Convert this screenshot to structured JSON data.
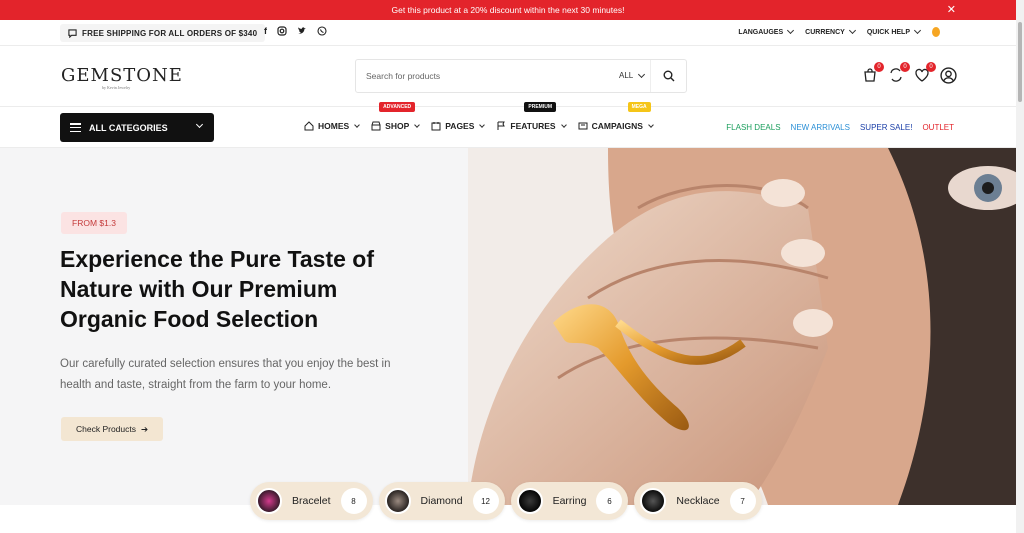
{
  "announcement": {
    "text": "Get this product at a 20% discount within the next 30 minutes!",
    "close_glyph": "✕"
  },
  "topbar": {
    "shipping": "FREE SHIPPING FOR ALL ORDERS OF $340",
    "socials": [
      "facebook-icon",
      "instagram-icon",
      "twitter-icon",
      "viber-icon"
    ],
    "languages": "LANGAUGES",
    "currency": "CURRENCY",
    "quick_help": "QUICK HELP"
  },
  "header": {
    "logo": "GEMSTONE",
    "logo_sub": "by Kevin Jewelry",
    "search_placeholder": "Search for products",
    "search_category": "ALL",
    "cart_count": "0",
    "compare_count": "0",
    "wishlist_count": "0"
  },
  "nav": {
    "all_categories": "ALL CATEGORIES",
    "menu": [
      {
        "label": "HOMES",
        "tag": ""
      },
      {
        "label": "SHOP",
        "tag": "ADVANCED"
      },
      {
        "label": "PAGES",
        "tag": ""
      },
      {
        "label": "FEATURES",
        "tag": "PREMIUM"
      },
      {
        "label": "CAMPAIGNS",
        "tag": "MEGA"
      }
    ],
    "promo": [
      {
        "label": "FLASH DEALS",
        "color": "#1a9e5c"
      },
      {
        "label": "NEW ARRIVALS",
        "color": "#2a8fd6"
      },
      {
        "label": "SUPER SALE!",
        "color": "#1b3fa8"
      },
      {
        "label": "OUTLET",
        "color": "#e3242b"
      }
    ],
    "tag_colors": {
      "ADVANCED": "#e3242b",
      "PREMIUM": "#111111",
      "MEGA": "#f5c518"
    }
  },
  "hero": {
    "badge": "FROM $1.3",
    "title": "Experience the Pure Taste of Nature with Our Premium Organic Food Selection",
    "description": "Our carefully curated selection ensures that you enjoy the best in health and taste, straight from the farm to your home.",
    "cta": "Check Products"
  },
  "categories": [
    {
      "label": "Bracelet",
      "count": "8"
    },
    {
      "label": "Diamond",
      "count": "12"
    },
    {
      "label": "Earring",
      "count": "6"
    },
    {
      "label": "Necklace",
      "count": "7"
    }
  ]
}
